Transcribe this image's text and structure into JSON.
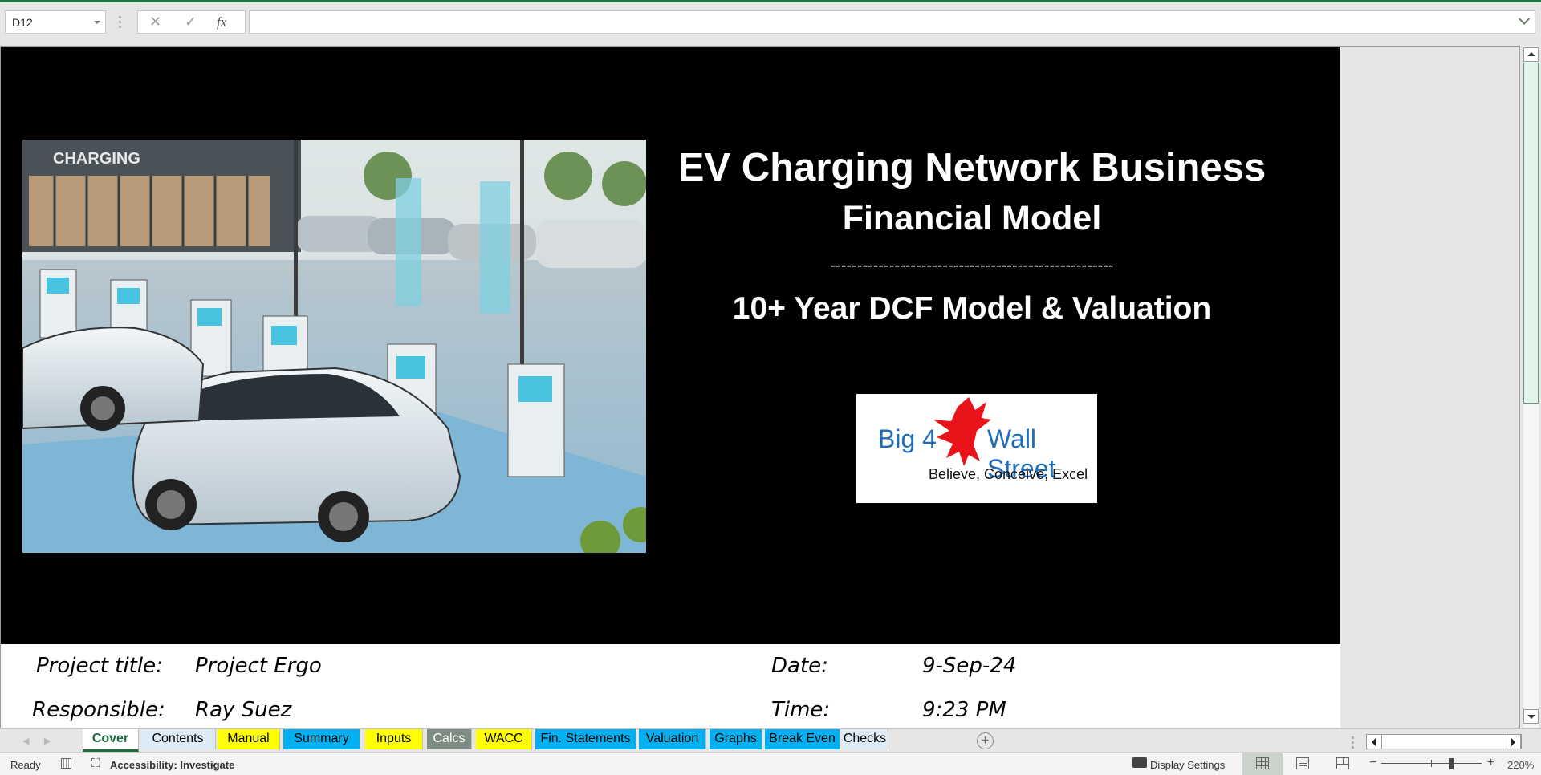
{
  "formula_bar": {
    "name_box": "D12",
    "cancel_icon": "✕",
    "enter_icon": "✓",
    "fx_label": "fx",
    "formula_value": ""
  },
  "cover": {
    "title_line1": "EV Charging Network Business",
    "title_line2": "Financial Model",
    "separator": "-----------------------------------------------------",
    "title_line3": "10+ Year DCF Model & Valuation",
    "photo_sign_text": "CHARGING",
    "logo": {
      "left_text": "Big 4",
      "right_text": "Wall Street",
      "tagline": "Believe, Conceive, Excel",
      "brand_color": "#1f6db8",
      "eagle_color": "#e8141a"
    },
    "info": {
      "project_label": "Project title:",
      "project_value": "Project Ergo",
      "responsible_label": "Responsible:",
      "responsible_value": "Ray Suez",
      "date_label": "Date:",
      "date_value": "9-Sep-24",
      "time_label": "Time:",
      "time_value": "9:23 PM"
    }
  },
  "sheet_tabs": [
    {
      "label": "Cover",
      "color": "#ffffff",
      "active": true
    },
    {
      "label": "Contents",
      "color": "#ddebf7",
      "active": false
    },
    {
      "label": "Manual",
      "color": "#ffff00",
      "active": false
    },
    {
      "label": "Summary",
      "color": "#00b0f0",
      "active": false
    },
    {
      "label": "Inputs",
      "color": "#ffff00",
      "active": false
    },
    {
      "label": "Calcs",
      "color": "#7f8c84",
      "active": false
    },
    {
      "label": "WACC",
      "color": "#ffff00",
      "active": false
    },
    {
      "label": "Fin. Statements",
      "color": "#00b0f0",
      "active": false
    },
    {
      "label": "Valuation",
      "color": "#00b0f0",
      "active": false
    },
    {
      "label": "Graphs",
      "color": "#00b0f0",
      "active": false
    },
    {
      "label": "Break Even",
      "color": "#00b0f0",
      "active": false
    },
    {
      "label": "Checks",
      "color": "#ddebf7",
      "active": false
    }
  ],
  "tab_bar": {
    "add_sheet_icon": "+",
    "prev_icon": "◀",
    "next_icon": "▶"
  },
  "status_bar": {
    "ready": "Ready",
    "accessibility": "Accessibility: Investigate",
    "accessibility_icon": "⛶",
    "display_settings": "Display Settings",
    "zoom_minus": "−",
    "zoom_plus": "+",
    "zoom_level": "220%"
  },
  "colors": {
    "excel_green": "#217346",
    "cover_background": "#000000",
    "title_text": "#ffffff"
  }
}
